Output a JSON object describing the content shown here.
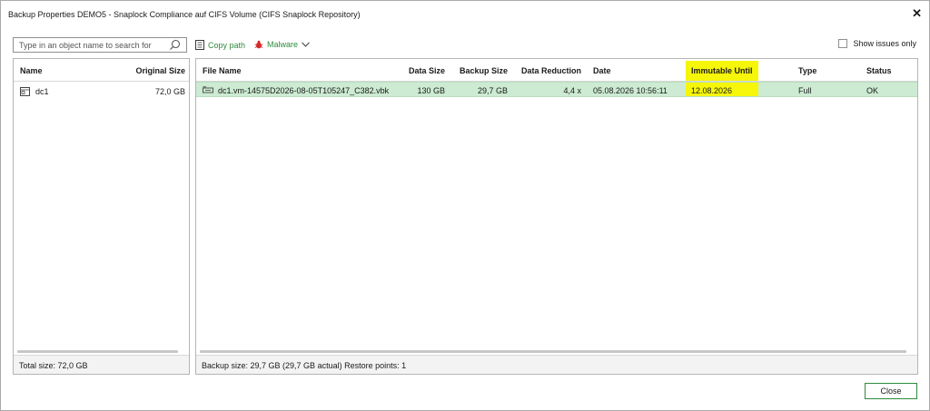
{
  "window": {
    "title": "Backup Properties DEMO5 - Snaplock Compliance auf CIFS Volume (CIFS Snaplock Repository)",
    "close_icon": "close-icon"
  },
  "toolbar": {
    "search_placeholder": "Type in an object name to search for",
    "copy_path_label": "Copy path",
    "malware_label": "Malware",
    "show_issues_label": "Show issues only",
    "show_issues_checked": false
  },
  "left_panel": {
    "columns": {
      "name": "Name",
      "original_size": "Original Size"
    },
    "rows": [
      {
        "name": "dc1",
        "original_size": "72,0 GB"
      }
    ],
    "footer": "Total size: 72,0 GB"
  },
  "right_panel": {
    "columns": {
      "file_name": "File Name",
      "data_size": "Data Size",
      "backup_size": "Backup Size",
      "data_reduction": "Data Reduction",
      "date": "Date",
      "immutable_until": "Immutable Until",
      "type": "Type",
      "status": "Status"
    },
    "rows": [
      {
        "file_name": "dc1.vm-14575D2026-08-05T105247_C382.vbk",
        "data_size": "130 GB",
        "backup_size": "29,7 GB",
        "data_reduction": "4,4 x",
        "date": "05.08.2026 10:56:11",
        "immutable_until": "12.08.2026",
        "type": "Full",
        "status": "OK"
      }
    ],
    "footer": "Backup size: 29,7 GB (29,7 GB actual)  Restore points: 1"
  },
  "buttons": {
    "close_label": "Close"
  },
  "colors": {
    "accent_green": "#2e8b3a",
    "selected_row": "#ccebd2",
    "highlight": "#f6f60a",
    "malware_red": "#d42a2a"
  }
}
